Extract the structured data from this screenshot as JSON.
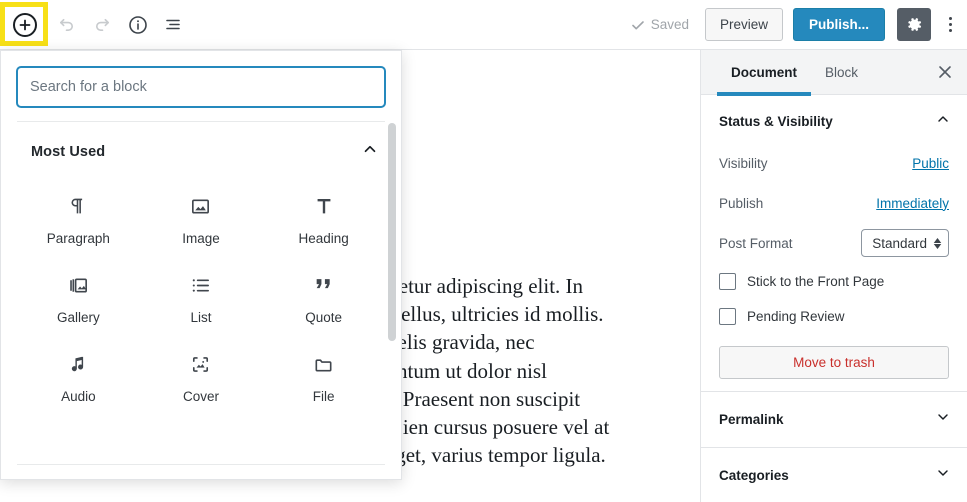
{
  "toolbar": {
    "inserter_label": "Add block",
    "undo_label": "Undo",
    "redo_label": "Redo",
    "info_label": "Content structure",
    "block_nav_label": "Block navigation",
    "saved_label": "Saved",
    "preview_label": "Preview",
    "publish_label": "Publish...",
    "settings_label": "Settings",
    "more_label": "More tools & options",
    "publish_color": "#2589bd",
    "highlight_color": "#f7e017"
  },
  "inserter": {
    "search": {
      "placeholder": "Search for a block",
      "value": ""
    },
    "section": {
      "title": "Most Used",
      "expanded": true
    },
    "blocks": [
      {
        "label": "Paragraph",
        "icon": "paragraph-icon"
      },
      {
        "label": "Image",
        "icon": "image-icon"
      },
      {
        "label": "Heading",
        "icon": "heading-icon"
      },
      {
        "label": "Gallery",
        "icon": "gallery-icon"
      },
      {
        "label": "List",
        "icon": "list-icon"
      },
      {
        "label": "Quote",
        "icon": "quote-icon"
      },
      {
        "label": "Audio",
        "icon": "audio-icon"
      },
      {
        "label": "Cover",
        "icon": "cover-icon"
      },
      {
        "label": "File",
        "icon": "file-icon"
      }
    ]
  },
  "editor": {
    "post_text": "Lorem ipsum dolor sit amet, consectetur adipiscing elit. In vehicula convallis nunc, non tempo tellus, ultricies id mollis. Ut nec dolor ut ante laoreet dolor a felis gravida, nec tincidunt quam blandit lectus, elementum ut dolor nisl placerat, eu aliquam porttitor massa. Praesent non suscipit dui, nec congue lectus. Sed mi id sapien cursus posuere vel at lorem. Etiam euismod nec gravida eget, varius tempor ligula."
  },
  "sidebar": {
    "tabs": [
      {
        "label": "Document",
        "active": true
      },
      {
        "label": "Block",
        "active": false
      }
    ],
    "close_label": "Close settings",
    "status_panel": {
      "title": "Status & Visibility",
      "expanded": true,
      "visibility_label": "Visibility",
      "visibility_value": "Public",
      "publish_label": "Publish",
      "publish_value": "Immediately",
      "post_format_label": "Post Format",
      "post_format_value": "Standard",
      "sticky_label": "Stick to the Front Page",
      "sticky_checked": false,
      "pending_label": "Pending Review",
      "pending_checked": false,
      "trash_label": "Move to trash",
      "trash_color": "#c9302c"
    },
    "collapsed_panels": [
      {
        "title": "Permalink"
      },
      {
        "title": "Categories"
      }
    ]
  }
}
